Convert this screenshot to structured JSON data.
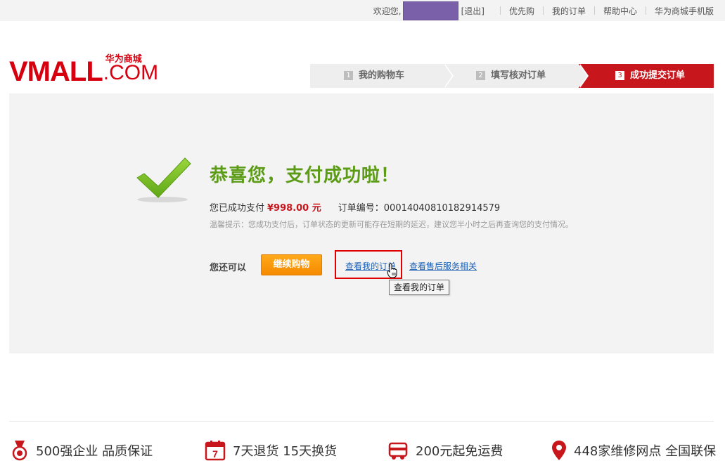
{
  "topbar": {
    "welcome": "欢迎您,",
    "logout": "[退出]",
    "links": [
      "优先购",
      "我的订单",
      "帮助中心",
      "华为商城手机版"
    ]
  },
  "logo": {
    "main": "VMALL",
    "suffix": ".COM",
    "cn": "华为商城"
  },
  "steps": [
    {
      "num": "1",
      "label": "我的购物车"
    },
    {
      "num": "2",
      "label": "填写核对订单"
    },
    {
      "num": "3",
      "label": "成功提交订单"
    }
  ],
  "result": {
    "title": "恭喜您，支付成功啦！",
    "paid_prefix": "您已成功支付",
    "amount": "¥998.00 元",
    "order_label": "订单编号：",
    "order_no": "00014040810182914579",
    "tip": "温馨提示：您成功支付后，订单状态的更新可能存在短期的延迟，建议您半小时之后再查询您的支付情况。",
    "actions_label": "您还可以",
    "continue_button": "继续购物",
    "orders_link": "查看我的订单",
    "service_link": "查看售后服务相关",
    "tooltip": "查看我的订单"
  },
  "features": [
    {
      "icon": "medal-icon",
      "text": "500强企业 品质保证"
    },
    {
      "icon": "calendar-7-icon",
      "text": "7天退货 15天换货"
    },
    {
      "icon": "truck-icon",
      "text": "200元起免运费"
    },
    {
      "icon": "location-pin-icon",
      "text": "448家维修网点 全国联保"
    }
  ],
  "colors": {
    "brand_red": "#d6000f",
    "success_green": "#5b9b16",
    "link_blue": "#1a5fb4",
    "button_orange": "#f68a00"
  }
}
